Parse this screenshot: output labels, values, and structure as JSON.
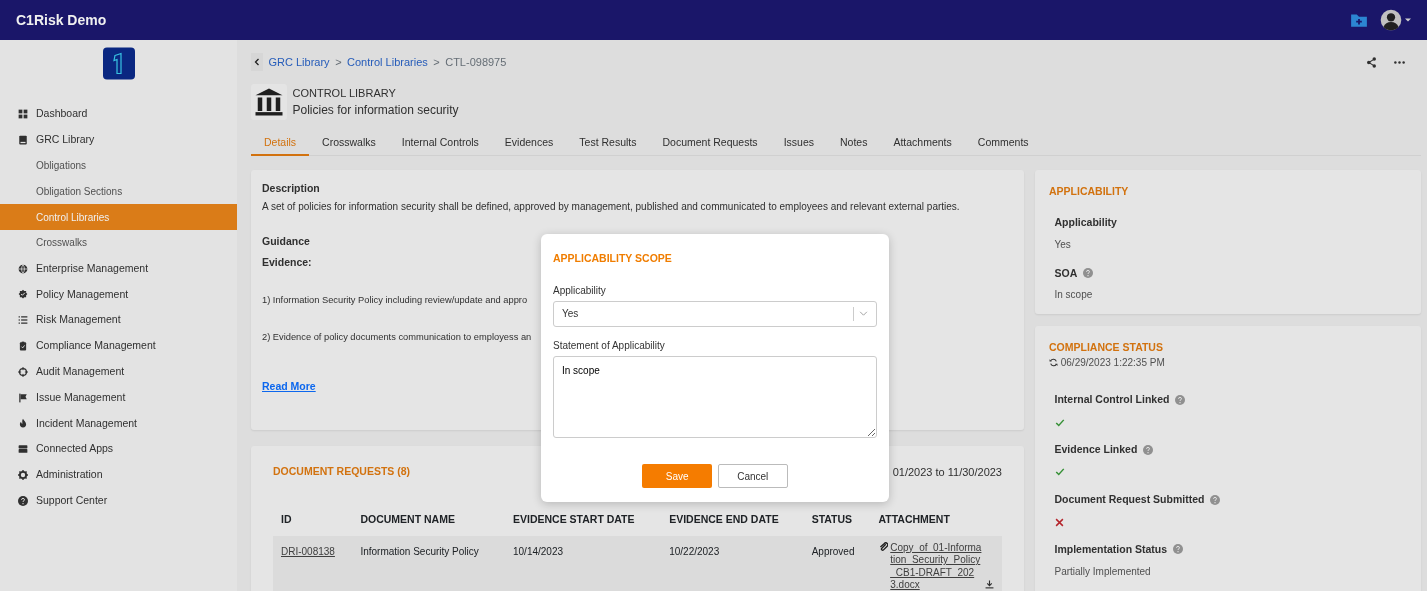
{
  "app": {
    "title": "C1Risk Demo"
  },
  "sidebar": {
    "items": [
      {
        "label": "Dashboard",
        "selected": false
      },
      {
        "label": "GRC Library",
        "selected": false,
        "children": [
          {
            "label": "Obligations",
            "selected": false
          },
          {
            "label": "Obligation Sections",
            "selected": false
          },
          {
            "label": "Control Libraries",
            "selected": true
          },
          {
            "label": "Crosswalks",
            "selected": false
          }
        ]
      },
      {
        "label": "Enterprise Management",
        "selected": false
      },
      {
        "label": "Policy Management",
        "selected": false
      },
      {
        "label": "Risk Management",
        "selected": false
      },
      {
        "label": "Compliance Management",
        "selected": false
      },
      {
        "label": "Audit Management",
        "selected": false
      },
      {
        "label": "Issue Management",
        "selected": false
      },
      {
        "label": "Incident Management",
        "selected": false
      },
      {
        "label": "Connected Apps",
        "selected": false
      },
      {
        "label": "Administration",
        "selected": false
      },
      {
        "label": "Support Center",
        "selected": false
      }
    ]
  },
  "breadcrumb": [
    {
      "label": "GRC Library",
      "kind": "link"
    },
    {
      "label": ">",
      "kind": "separator"
    },
    {
      "label": "Control Libraries",
      "kind": "link"
    },
    {
      "label": ">",
      "kind": "separator"
    },
    {
      "label": "CTL-098975",
      "kind": "current"
    }
  ],
  "header": {
    "type": "CONTROL LIBRARY",
    "title": "Policies for information security"
  },
  "tabs": [
    {
      "label": "Details",
      "selected": true
    },
    {
      "label": "Crosswalks",
      "selected": false
    },
    {
      "label": "Internal Controls",
      "selected": false
    },
    {
      "label": "Evidences",
      "selected": false
    },
    {
      "label": "Test Results",
      "selected": false
    },
    {
      "label": "Document Requests",
      "selected": false
    },
    {
      "label": "Issues",
      "selected": false
    },
    {
      "label": "Notes",
      "selected": false
    },
    {
      "label": "Attachments",
      "selected": false
    },
    {
      "label": "Comments",
      "selected": false
    }
  ],
  "details": {
    "description_label": "Description",
    "description": "A set of policies for information security shall be defined, approved by management, published and communicated to employees and relevant external parties.",
    "guidance_label": "Guidance",
    "evidence_label": "Evidence:",
    "evidence_lines": [
      "1) Information Security Policy including review/update and appro",
      "2) Evidence of policy documents communication to employess an"
    ],
    "read_more": "Read More"
  },
  "document_requests": {
    "title": "DOCUMENT REQUESTS (8)",
    "date_range": "01/2023 to 11/30/2023",
    "columns": [
      "ID",
      "DOCUMENT NAME",
      "EVIDENCE START DATE",
      "EVIDENCE END DATE",
      "STATUS",
      "ATTACHMENT"
    ],
    "rows": [
      {
        "id": "DRI-008138",
        "document_name": "Information Security Policy",
        "start_date": "10/14/2023",
        "end_date": "10/22/2023",
        "status": "Approved",
        "attachment": "Copy_of_01-Information_Security_Policy_CB1-DRAFT_2023.docx"
      }
    ]
  },
  "applicability": {
    "title": "APPLICABILITY",
    "fields": [
      {
        "label": "Applicability",
        "value": "Yes",
        "help": false
      },
      {
        "label": "SOA",
        "value": "In scope",
        "help": true
      }
    ]
  },
  "compliance_status": {
    "title": "COMPLIANCE STATUS",
    "updated": "06/29/2023 1:22:35 PM",
    "items": [
      {
        "label": "Internal Control Linked",
        "help": true,
        "kind": "status",
        "passed": true
      },
      {
        "label": "Evidence Linked",
        "help": true,
        "kind": "status",
        "passed": true
      },
      {
        "label": "Document Request Submitted",
        "help": true,
        "kind": "status",
        "passed": false
      },
      {
        "label": "Implementation Status",
        "help": true,
        "kind": "text",
        "value": "Partially Implemented"
      }
    ]
  },
  "modal": {
    "title": "APPLICABILITY SCOPE",
    "select_label": "Applicability",
    "select_value": "Yes",
    "text_label": "Statement of Applicability",
    "text_value": "In scope",
    "buttons": [
      {
        "label": "Save",
        "kind": "primary"
      },
      {
        "label": "Cancel",
        "kind": "secondary"
      }
    ]
  }
}
